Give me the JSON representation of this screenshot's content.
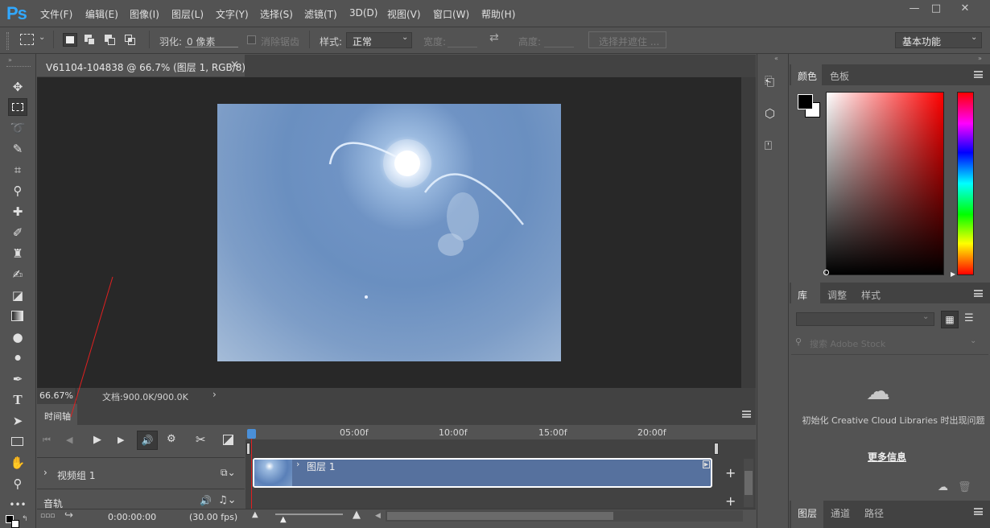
{
  "app": {
    "logo": "Ps"
  },
  "menu": [
    "文件(F)",
    "编辑(E)",
    "图像(I)",
    "图层(L)",
    "文字(Y)",
    "选择(S)",
    "滤镜(T)",
    "3D(D)",
    "视图(V)",
    "窗口(W)",
    "帮助(H)"
  ],
  "window_controls": {
    "minimize": "—",
    "maximize": "□",
    "close": "✕"
  },
  "options": {
    "feather_label": "羽化:",
    "feather_value": "0 像素",
    "antialias_label": "消除锯齿",
    "style_label": "样式:",
    "style_value": "正常",
    "width_label": "宽度:",
    "height_label": "高度:",
    "select_mask_button": "选择并遮住 ...",
    "workspace": "基本功能"
  },
  "document": {
    "tab_title": "V61104-104838 @ 66.7% (图层 1, RGB/8)",
    "close_glyph": "×",
    "zoom": "66.67%",
    "doc_info": "文档:900.0K/900.0K",
    "status_arrow": "›"
  },
  "timeline": {
    "tab_label": "时间轴",
    "ruler_labels": [
      "05:00f",
      "10:00f",
      "15:00f",
      "20:00f"
    ],
    "video_group_label": "视频组 1",
    "layer_clip_label": "图层 1",
    "audio_label": "音轨",
    "timecode": "0:00:00:00",
    "fps": "(30.00 fps)",
    "expand_glyph": "›",
    "add_glyph": "+"
  },
  "color_panel": {
    "tabs": [
      "颜色",
      "色板"
    ]
  },
  "library_panel": {
    "tabs": [
      "库",
      "调整",
      "样式"
    ],
    "search_placeholder": "搜索 Adobe Stock",
    "init_message": "初始化 Creative Cloud Libraries 时出现问题",
    "more_info": "更多信息"
  },
  "layers_panel": {
    "tabs": [
      "图层",
      "通道",
      "路径"
    ]
  },
  "colors": {
    "accent": "#31a8ff",
    "clip": "#56719e",
    "playhead": "#4a90d9",
    "annotation": "#e02020"
  }
}
